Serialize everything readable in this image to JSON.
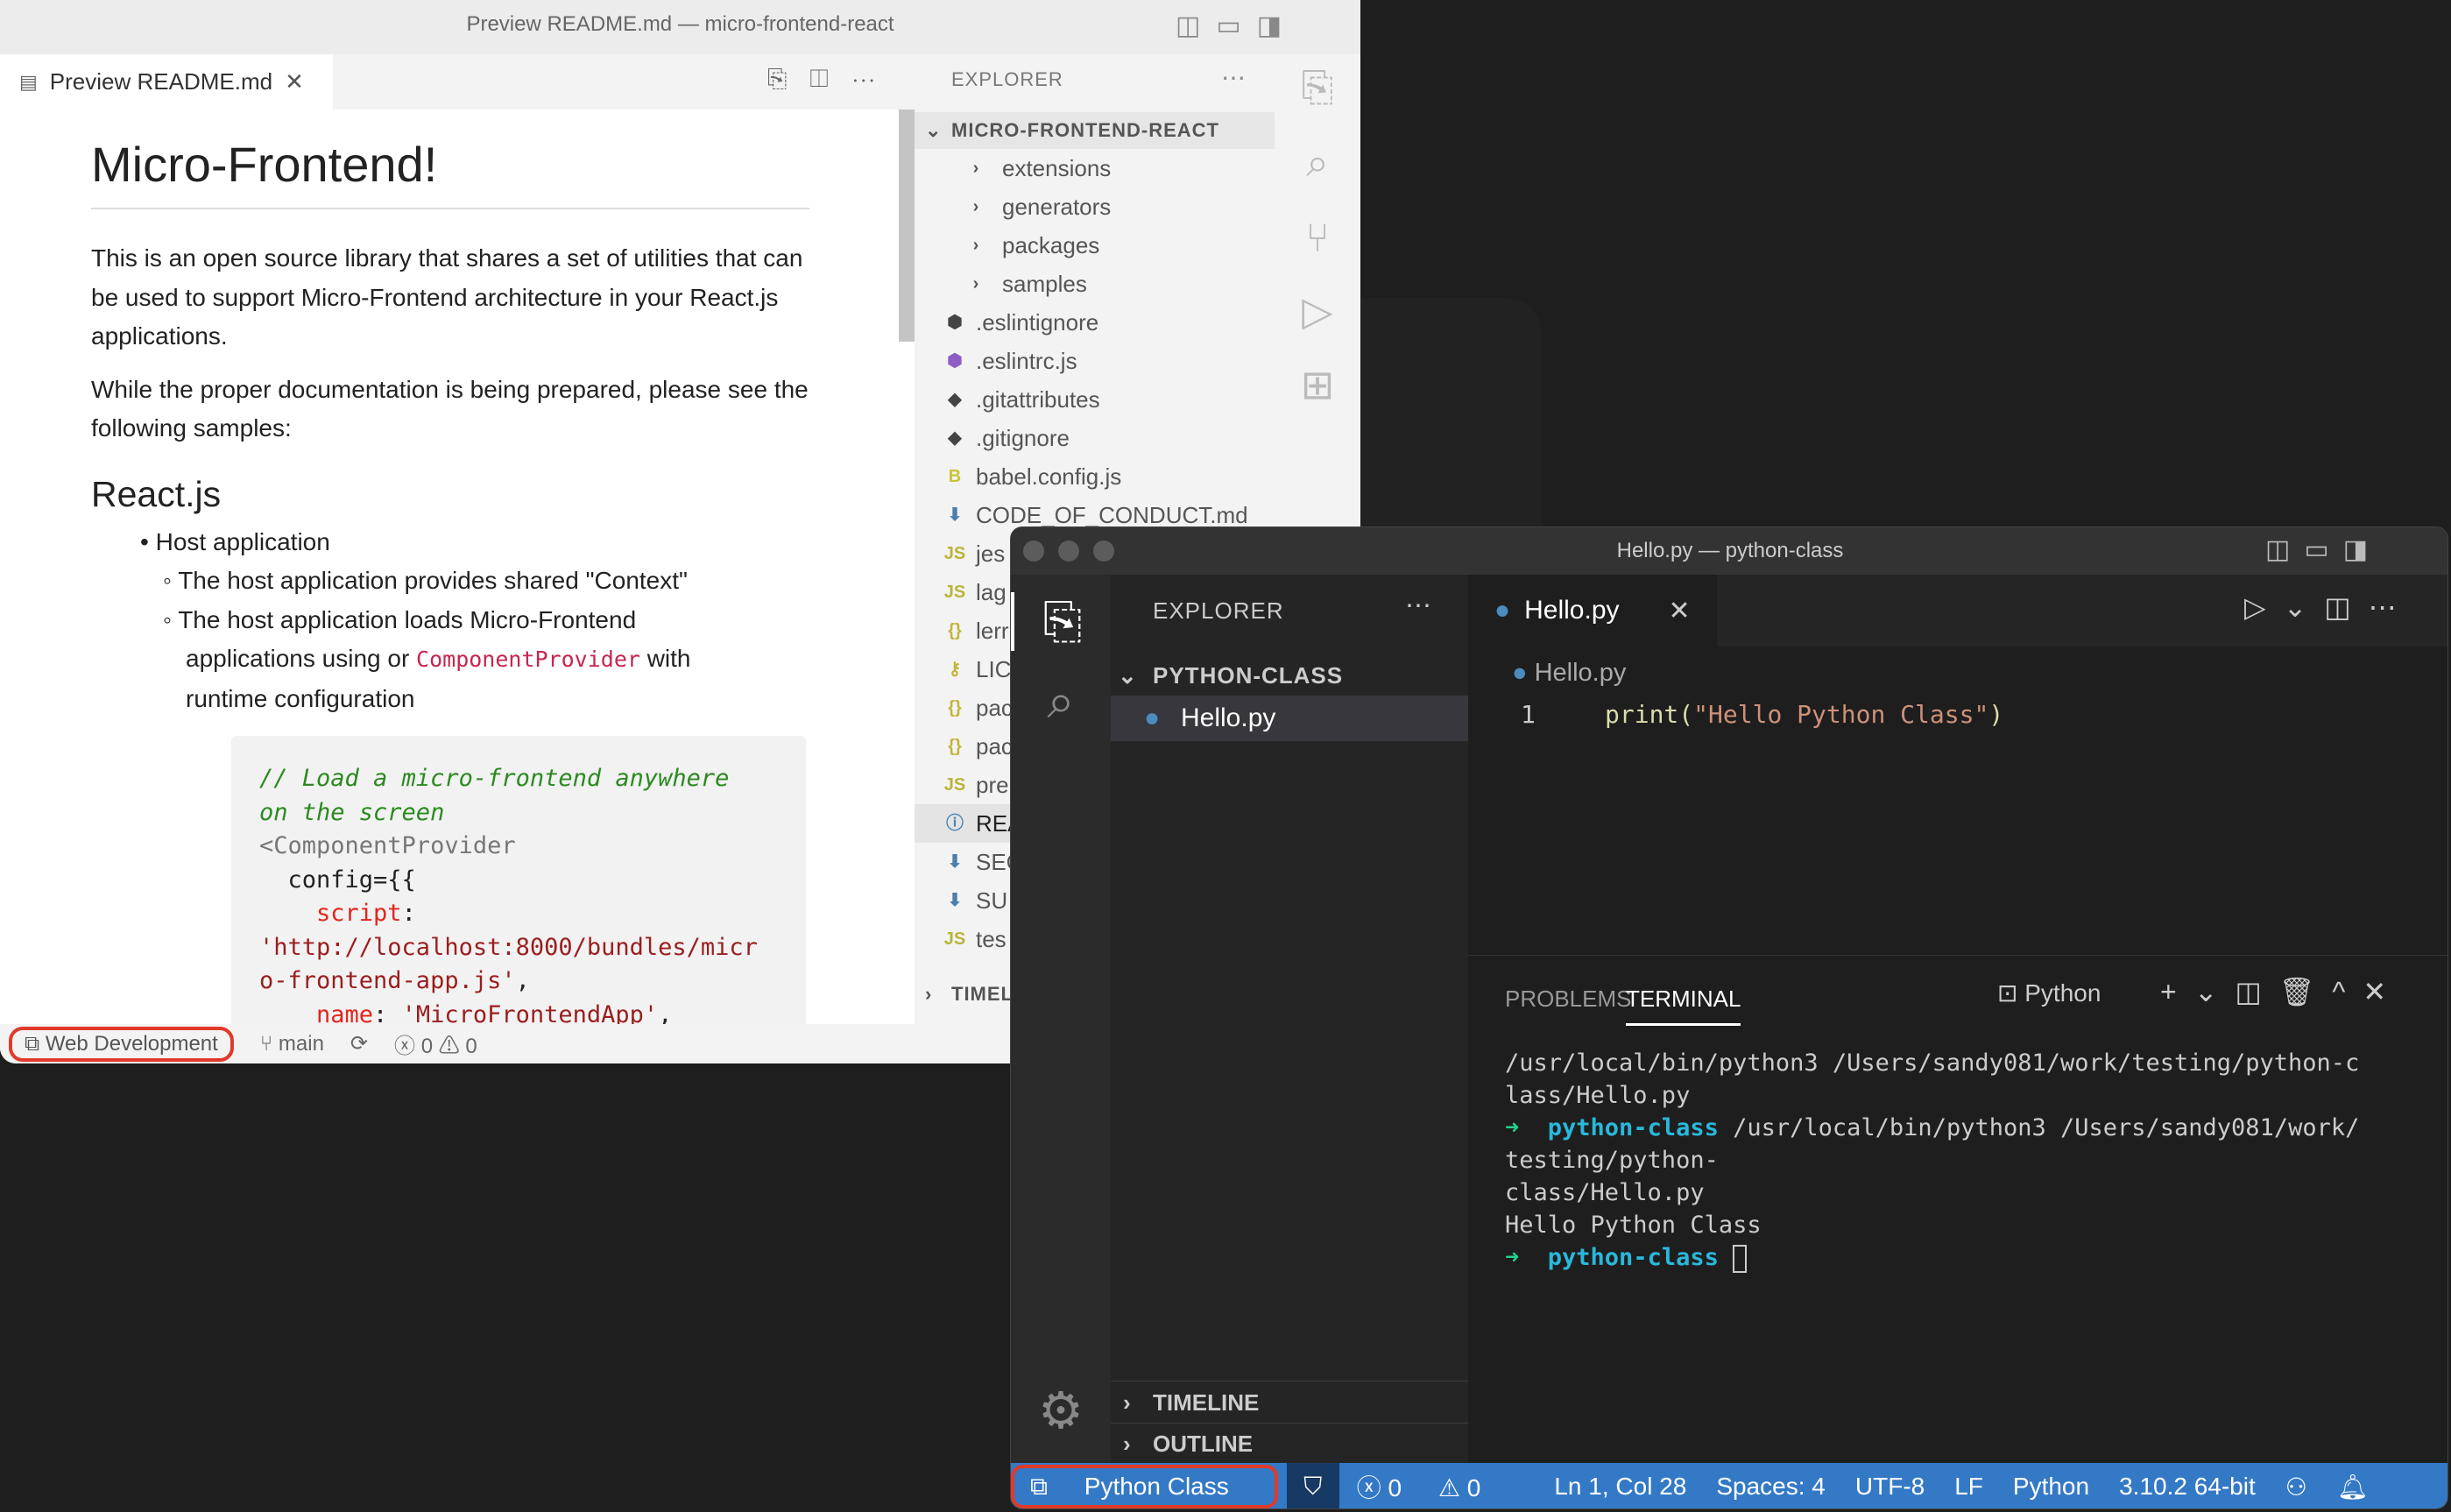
{
  "light": {
    "title": "Preview README.md — micro-frontend-react",
    "tab": "Preview README.md",
    "readme": {
      "h1": "Micro-Frontend!",
      "p1": "This is an open source library that shares a set of utilities that can be used to support Micro-Frontend architecture in your React.js applications.",
      "p2": "While the proper documentation is being prepared, please see the following samples:",
      "h2": "React.js",
      "li1": "Host application",
      "sub1": "The host application provides shared \"Context\"",
      "sub2a": "The host application loads Micro-Frontend applications using or ",
      "sub2code": "ComponentProvider",
      "sub2b": " with runtime configuration",
      "code": {
        "c1": "// Load a micro-frontend anywhere",
        "c2": "on the screen",
        "c3": "<ComponentProvider",
        "c4": "  config={{",
        "c5k": "    script",
        "c6": "'http://localhost:8000/bundles/micr",
        "c7": "o-frontend-app.js'",
        "c8k": "    name",
        "c8v": "'MicroFrontendApp'"
      }
    },
    "explorer": {
      "header": "EXPLORER",
      "root": "MICRO-FRONTEND-REACT",
      "timeline": "TIMEL",
      "items": [
        {
          "icon": "chevron",
          "name": "extensions"
        },
        {
          "icon": "chevron",
          "name": "generators"
        },
        {
          "icon": "chevron",
          "name": "packages"
        },
        {
          "icon": "chevron",
          "name": "samples"
        },
        {
          "icon": "eslint",
          "name": ".eslintignore"
        },
        {
          "icon": "eslint-purple",
          "name": ".eslintrc.js"
        },
        {
          "icon": "git",
          "name": ".gitattributes"
        },
        {
          "icon": "git",
          "name": ".gitignore"
        },
        {
          "icon": "babel",
          "name": "babel.config.js"
        },
        {
          "icon": "markdown",
          "name": "CODE_OF_CONDUCT.md"
        },
        {
          "icon": "js",
          "name": "jes"
        },
        {
          "icon": "js",
          "name": "lag"
        },
        {
          "icon": "json",
          "name": "lerr"
        },
        {
          "icon": "license",
          "name": "LIC"
        },
        {
          "icon": "json",
          "name": "pac"
        },
        {
          "icon": "json",
          "name": "pac"
        },
        {
          "icon": "js",
          "name": "pre"
        },
        {
          "icon": "info",
          "name": "REA"
        },
        {
          "icon": "markdown",
          "name": "SEC"
        },
        {
          "icon": "markdown",
          "name": "SU"
        },
        {
          "icon": "js",
          "name": "tes"
        }
      ]
    },
    "status": {
      "remote": "Web Development",
      "branch": "main",
      "errors": "0",
      "warnings": "0"
    }
  },
  "dark": {
    "title": "Hello.py — python-class",
    "explorer": {
      "header": "EXPLORER",
      "root": "PYTHON-CLASS",
      "file": "Hello.py",
      "timeline": "TIMELINE",
      "outline": "OUTLINE"
    },
    "editor": {
      "tab": "Hello.py",
      "breadcrumb": "Hello.py",
      "line_no": "1",
      "code_fn": "print(",
      "code_str": "\"Hello Python Class\"",
      "code_end": ")"
    },
    "panel": {
      "tabs": [
        "PROBLEMS",
        "TERMINAL"
      ],
      "shell": "Python",
      "lines": [
        {
          "text": "/usr/local/bin/python3 /Users/sandy081/work/testing/python-c"
        },
        {
          "text": "lass/Hello.py"
        },
        {
          "prompt": "python-class",
          "text": " /usr/local/bin/python3 /Users/sandy081/work/"
        },
        {
          "text": "testing/python-"
        },
        {
          "text": "class/Hello.py"
        },
        {
          "text": "Hello Python Class"
        },
        {
          "prompt": "python-class",
          "text": " "
        }
      ]
    },
    "status": {
      "remote": "Python Class",
      "errors": "0",
      "warnings": "0",
      "position": "Ln 1, Col 28",
      "spaces": "Spaces: 4",
      "encoding": "UTF-8",
      "eol": "LF",
      "language": "Python",
      "interpreter": "3.10.2 64-bit"
    }
  },
  "colors": {
    "status_blue": "#3479c6",
    "remote_highlight": "#e03a2a",
    "prompt": "#29b8db",
    "arrow": "#23d18b"
  }
}
